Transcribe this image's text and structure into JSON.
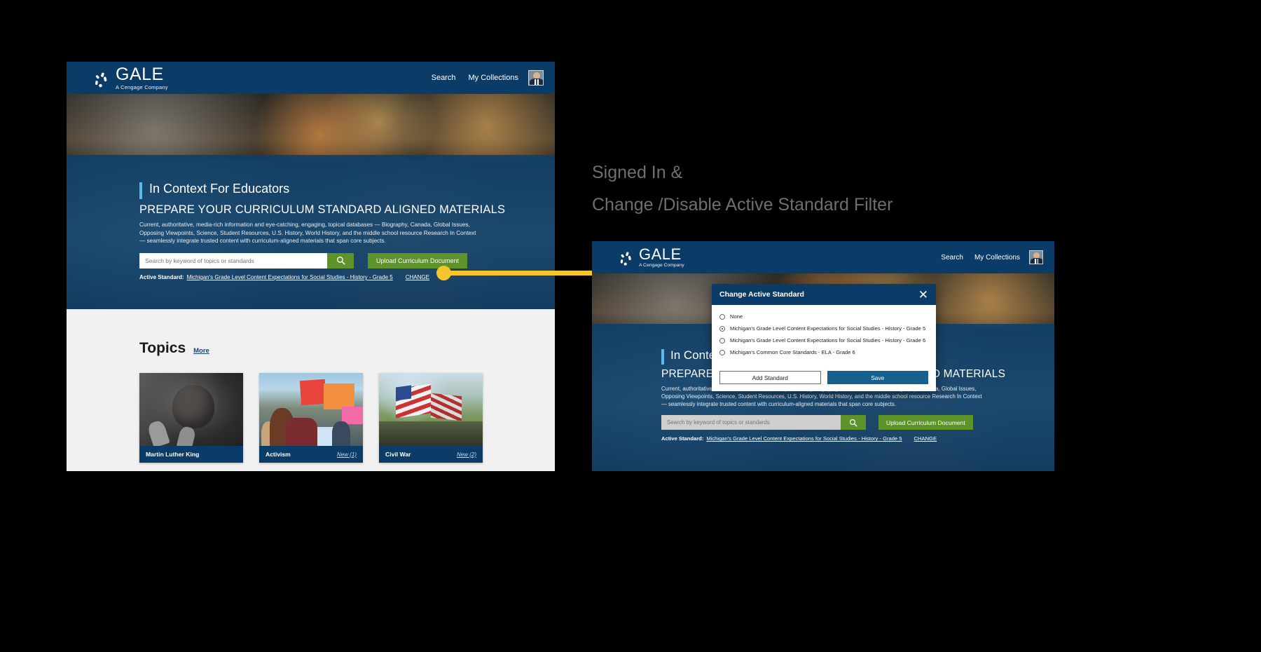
{
  "annotation": {
    "line1": "Signed In &",
    "line2": "Change /Disable Active Standard Filter"
  },
  "brand": {
    "name": "GALE",
    "tagline": "A Cengage Company",
    "navy": "#0b3c68",
    "green": "#5d9328",
    "accent": "#5bb8e8",
    "callout": "#f5c52b"
  },
  "nav": {
    "search_label": "Search",
    "collections_label": "My Collections",
    "avatar_name": "user-avatar"
  },
  "hero": {
    "kicker": "In Context For Educators",
    "title": "PREPARE YOUR CURRICULUM STANDARD ALIGNED MATERIALS",
    "description": "Current, authoritative, media-rich information and eye-catching, engaging, topical databases — Biography, Canada, Global Issues, Opposing Viewpoints, Science, Student Resources, U.S. History, World History, and the middle school resource Research In Context — seamlessly integrate trusted content with curriculum-aligned materials that span core subjects.",
    "search_placeholder": "Search by keyword of topics or standards",
    "search_value": "",
    "search_icon": "magnifier-icon",
    "upload_label": "Upload Curriculum Document",
    "standard_label": "Active Standard:",
    "standard_value": "Michigan's Grade Level Content Expectations for Social Studies - History - Grade 5",
    "change_label": "CHANGE"
  },
  "topics": {
    "heading": "Topics",
    "more_label": "More",
    "cards": [
      {
        "title": "Martin Luther King",
        "badge": "",
        "image": "martin-luther-king-photo"
      },
      {
        "title": "Activism",
        "badge": "New (1)",
        "image": "activism-protest-photo"
      },
      {
        "title": "Civil War",
        "badge": "New (2)",
        "image": "civil-war-reenactment-photo"
      }
    ]
  },
  "modal": {
    "title": "Change Active Standard",
    "close_icon": "close-icon",
    "options": [
      {
        "label": "None",
        "selected": false
      },
      {
        "label": "Michigan's Grade Level Content Expectations for Social Studies - History - Grade 5",
        "selected": true
      },
      {
        "label": "Michigan's Grade Level Content Expectations for Social Studies - History - Grade 6",
        "selected": false
      },
      {
        "label": "Michigan's Common Core Standards - ELA - Grade 6",
        "selected": false
      }
    ],
    "add_label": "Add Standard",
    "save_label": "Save"
  }
}
